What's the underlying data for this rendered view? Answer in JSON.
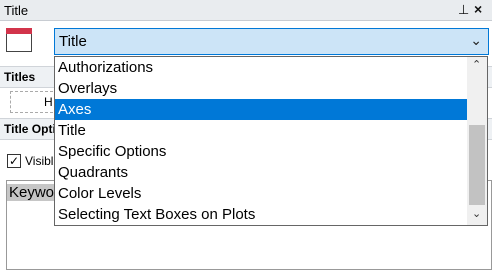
{
  "window": {
    "title": "Title",
    "pin_glyph": "⊥",
    "close_glyph": "×"
  },
  "combo": {
    "value": "Title",
    "chevron_glyph": "⌄"
  },
  "sections": {
    "titles_header": "Titles",
    "title_options_header": "Title Opti",
    "dashed_text": "H"
  },
  "visible_checkbox": {
    "label": "Visibl",
    "checked": true,
    "check_glyph": "✓"
  },
  "text_area": {
    "value": "Keywo"
  },
  "dropdown": {
    "items": [
      "Authorizations",
      "Overlays",
      "Axes",
      "Title",
      "Specific Options",
      "Quadrants",
      "Color Levels",
      "Selecting Text Boxes on Plots"
    ],
    "selected": "Axes",
    "scroll_up_glyph": "⌃",
    "scroll_down_glyph": "⌄"
  },
  "colors": {
    "selection": "#0078d7",
    "combo_bg": "#cce4f7",
    "icon_red": "#d2344b"
  }
}
